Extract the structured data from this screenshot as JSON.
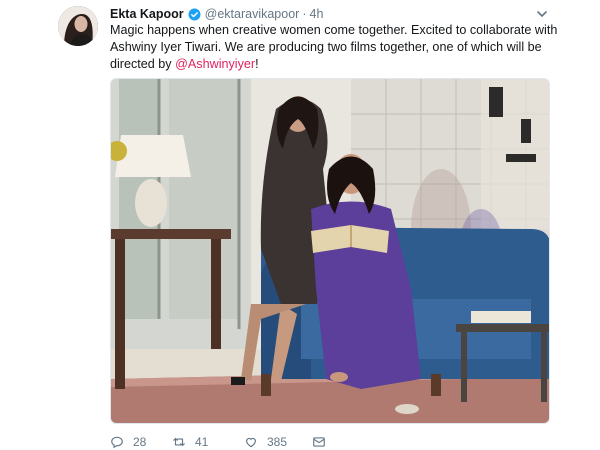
{
  "tweet": {
    "author_name": "Ekta Kapoor",
    "author_handle": "@ektaravikapoor",
    "separator": "·",
    "time": "4h",
    "text_line1": "Magic happens when creative women come together. Excited to collaborate with",
    "text_line2": "Ashwiny Iyer Tiwari. We are producing two films together, one of which will be",
    "text_line3_prefix": "directed by ",
    "mention": "@Ashwinyiyer",
    "text_line3_suffix": "!",
    "actions": {
      "replies": "28",
      "retweets": "41",
      "likes": "385"
    },
    "colors": {
      "verified": "#1da1f2",
      "mention": "#e0245e",
      "meta": "#657786"
    },
    "icons": [
      "verified-badge-icon",
      "chevron-down-icon",
      "reply-icon",
      "retweet-icon",
      "like-icon",
      "message-icon"
    ]
  }
}
